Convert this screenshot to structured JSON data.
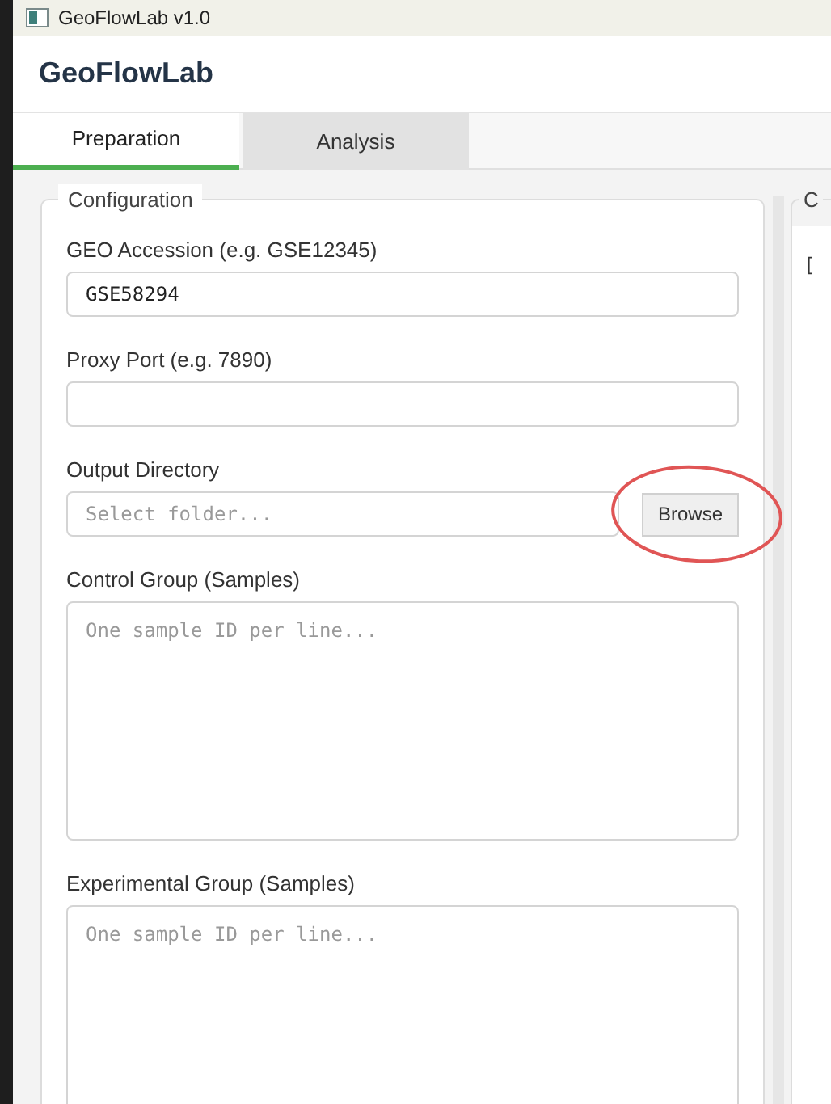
{
  "window": {
    "title": "GeoFlowLab v1.0"
  },
  "app_title": "GeoFlowLab",
  "tabs": [
    {
      "label": "Preparation",
      "selected": true
    },
    {
      "label": "Analysis",
      "selected": false
    }
  ],
  "configuration": {
    "title": "Configuration",
    "fields": [
      {
        "kind": "input",
        "label": "GEO Accession (e.g. GSE12345)",
        "value": "GSE58294"
      },
      {
        "kind": "input",
        "label": "Proxy Port (e.g. 7890)"
      },
      {
        "kind": "browse",
        "label": "Output Directory",
        "placeholder": "Select folder...",
        "button": "Browse",
        "highlighted": true
      },
      {
        "kind": "textarea",
        "label": "Control Group (Samples)",
        "placeholder": "One sample ID per line..."
      },
      {
        "kind": "textarea",
        "label": "Experimental Group (Samples)",
        "placeholder": "One sample ID per line..."
      }
    ]
  },
  "right_panel": {
    "title": "C",
    "log_text": "["
  }
}
